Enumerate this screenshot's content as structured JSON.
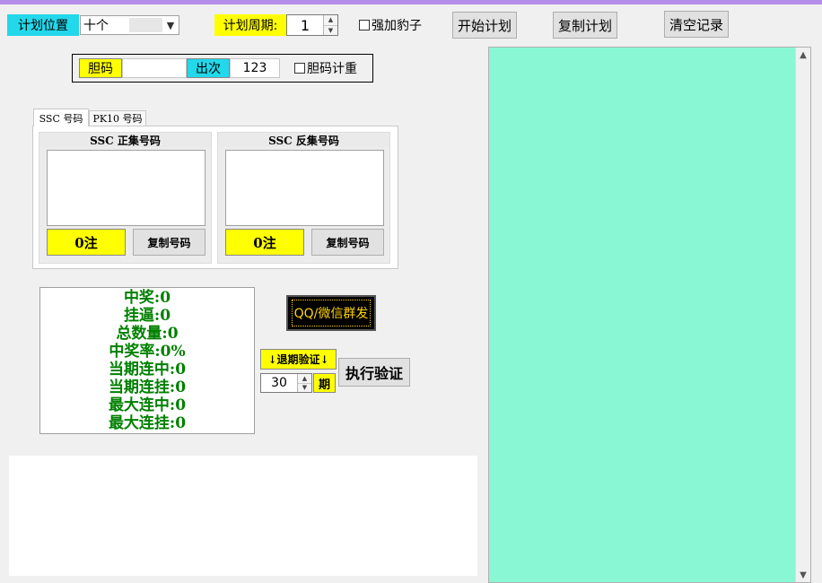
{
  "toolbar": {
    "plan_position_label": "计划位置",
    "plan_position_value": "十个",
    "plan_period_label": "计划周期:",
    "plan_period_value": "1",
    "force_leopard_label": "强加豹子",
    "start_plan_label": "开始计划",
    "copy_plan_label": "复制计划",
    "clear_records_label": "清空记录"
  },
  "filter": {
    "bold_code_label": "胆码",
    "bold_code_value": "",
    "appear_times_label": "出次",
    "appear_times_value": "123",
    "bold_code_weight_label": "胆码计重"
  },
  "tabs": [
    {
      "label": "SSC 号码"
    },
    {
      "label": "PK10 号码"
    }
  ],
  "ssc": {
    "positive": {
      "title": "SSC 正集号码",
      "count": "0注",
      "copy_label": "复制号码"
    },
    "negative": {
      "title": "SSC 反集号码",
      "count": "0注",
      "copy_label": "复制号码"
    }
  },
  "stats": [
    "中奖:0",
    "挂逼:0",
    "总数量:0",
    "中奖率:0%",
    "当期连中:0",
    "当期连挂:0",
    "最大连中:0",
    "最大连挂:0"
  ],
  "actions": {
    "qq_wechat_label": "QQ/微信群发",
    "back_verify_label": "↓退期验证↓",
    "period_count": "30",
    "period_unit": "期",
    "execute_verify_label": "执行验证"
  },
  "colors": {
    "accent_cyan": "#22d8ea",
    "highlight_yellow": "#ffff00",
    "output_panel": "#8af7d4",
    "stat_green": "#008000"
  }
}
